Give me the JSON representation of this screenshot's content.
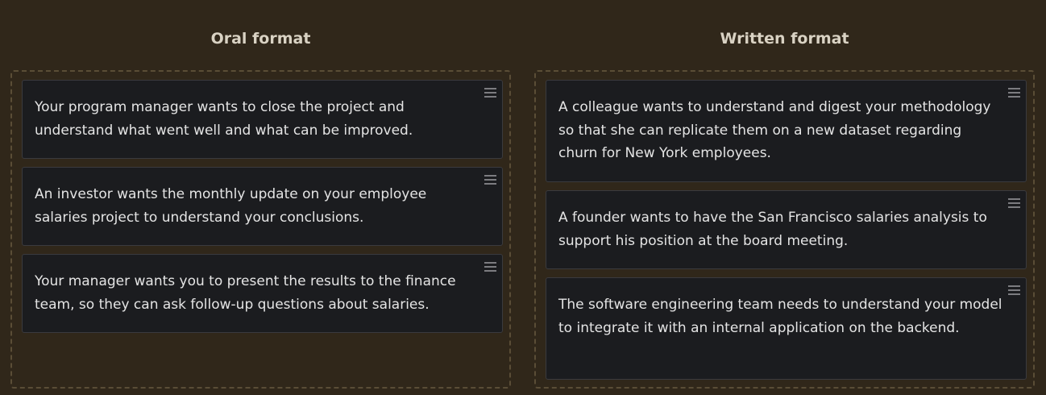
{
  "columns": {
    "oral": {
      "title": "Oral format",
      "cards": [
        {
          "text": "Your program manager wants to close the project and understand what went well and what can be improved."
        },
        {
          "text": "An investor wants the monthly update on your employee salaries project to understand your conclusions."
        },
        {
          "text": "Your manager wants you to present the results to the finance team, so they can ask follow-up questions about salaries."
        }
      ]
    },
    "written": {
      "title": "Written format",
      "cards": [
        {
          "text": "A colleague wants to understand and digest your methodology so that she can replicate them on a new dataset regarding churn for New York employees."
        },
        {
          "text": "A founder wants to have the San Francisco salaries analysis to support his position at the board meeting."
        },
        {
          "text": "The software engineering team needs to understand your model to integrate it with an internal application on the backend."
        }
      ]
    }
  },
  "icons": {
    "drag_handle": "drag-handle-icon"
  },
  "colors": {
    "background": "#30271a",
    "card_background": "#1b1c1f",
    "title_text": "#d9d2c3",
    "card_text": "#e4e4e4",
    "dropzone_border": "#5a4d36"
  }
}
